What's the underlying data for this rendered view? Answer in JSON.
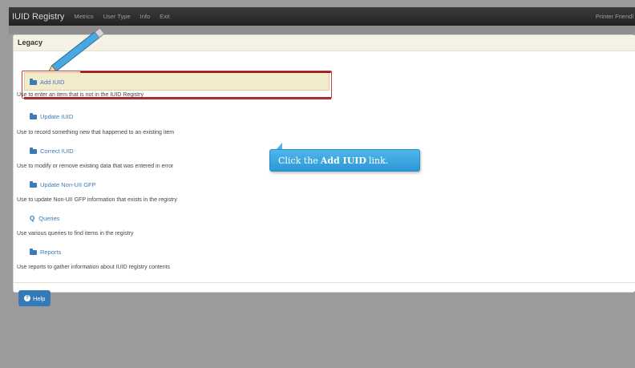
{
  "navbar": {
    "brand": "IUID Registry",
    "links": [
      "Metrics",
      "User Type",
      "Info",
      "Exit"
    ],
    "printer_friendly": "Printer Friendl"
  },
  "panel": {
    "title": "Legacy",
    "items": [
      {
        "label": "Add IUID",
        "icon": "folder-open-icon",
        "description": "Use to enter an item that is not in the IUID Registry"
      },
      {
        "label": "Update IUID",
        "icon": "folder-open-icon",
        "description": "Use to record something new that happened to an existing item"
      },
      {
        "label": "Correct IUID",
        "icon": "folder-open-icon",
        "description": "Use to modify or remove existing data that was entered in error"
      },
      {
        "label": "Update Non-UII GFP",
        "icon": "folder-open-icon",
        "description": "Use to update Non-UII GFP information that exists in the registry"
      },
      {
        "label": "Queries",
        "icon": "search-icon",
        "description": "Use various queries to find items in the registry"
      },
      {
        "label": "Reports",
        "icon": "folder-open-icon",
        "description": "Use reports to gather information about IUID registry contents"
      }
    ],
    "help_label": "Help"
  },
  "callout": {
    "prefix": "Click the",
    "bold": "Add IUID",
    "suffix": "link."
  },
  "colors": {
    "navbar": "#222222",
    "link": "#3a7ab7",
    "highlight": "#f2ebcc",
    "callout": "#2b98d6",
    "annotation_red": "#d23c3c"
  }
}
